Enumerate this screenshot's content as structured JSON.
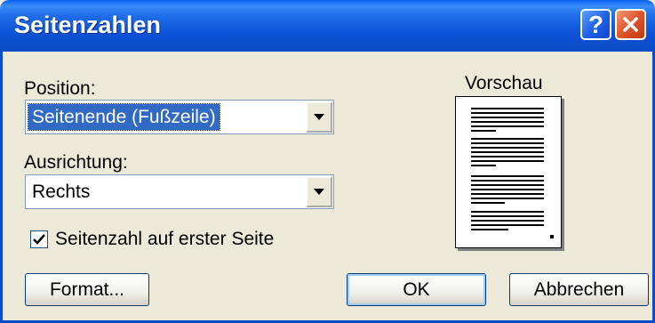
{
  "window": {
    "title": "Seitenzahlen"
  },
  "titlebar": {
    "help_label": "?",
    "close_icon": "close-icon"
  },
  "position": {
    "label": "Position:",
    "selected": "Seitenende (Fußzeile)"
  },
  "alignment": {
    "label": "Ausrichtung:",
    "selected": "Rechts"
  },
  "first_page": {
    "label": "Seitenzahl auf erster Seite",
    "checked": true
  },
  "preview": {
    "label": "Vorschau"
  },
  "buttons": {
    "format": "Format...",
    "ok": "OK",
    "cancel": "Abbrechen"
  },
  "colors": {
    "titlebar": "#0B4CC8",
    "selection": "#316AC5",
    "dialog_bg": "#ECE9D8",
    "close_button": "#E0542A"
  }
}
